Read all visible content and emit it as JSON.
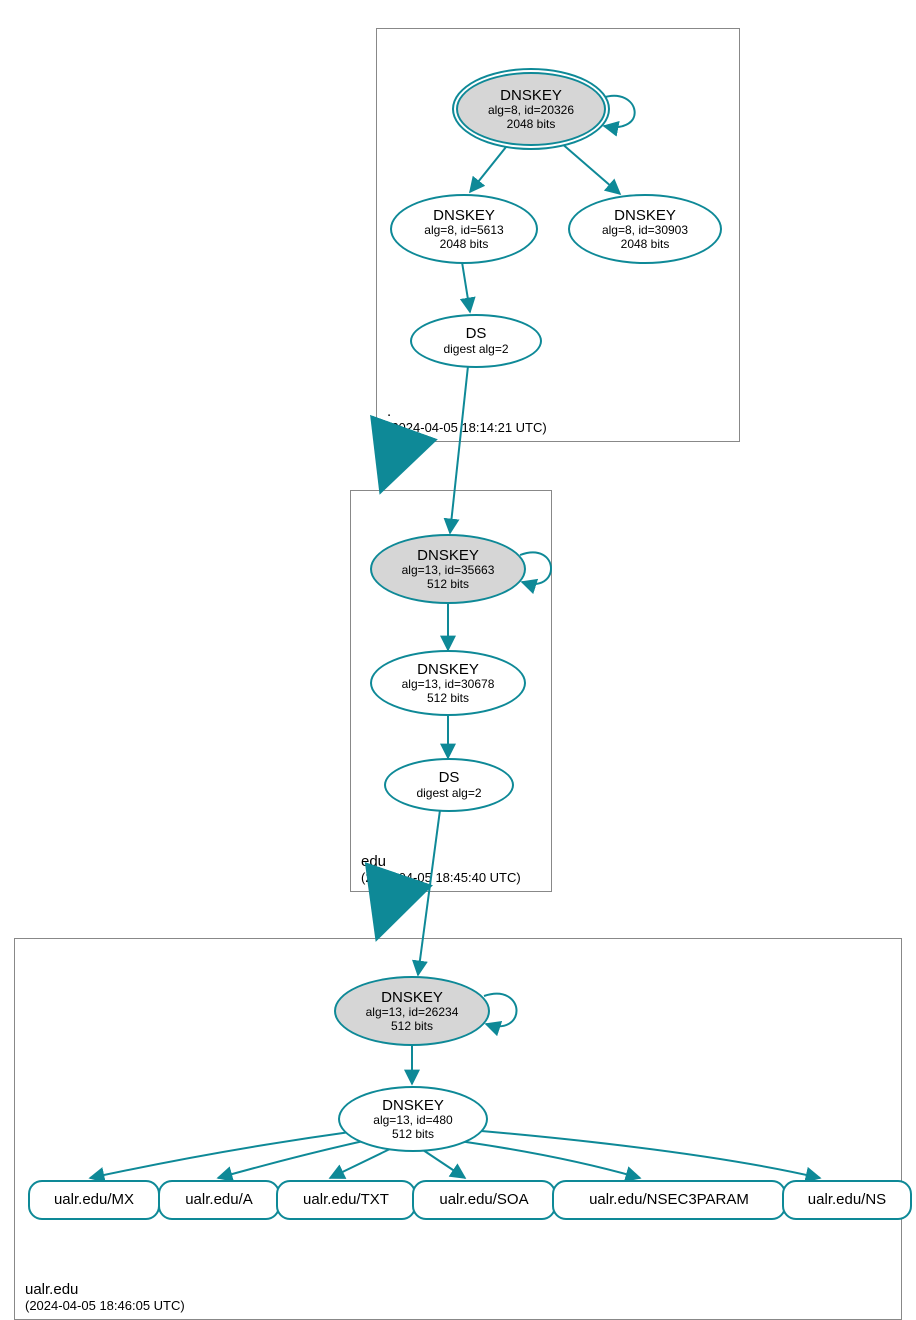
{
  "zones": {
    "root": {
      "name": ".",
      "timestamp": "(2024-04-05 18:14:21 UTC)"
    },
    "edu": {
      "name": "edu",
      "timestamp": "(2024-04-05 18:45:40 UTC)"
    },
    "ualr": {
      "name": "ualr.edu",
      "timestamp": "(2024-04-05 18:46:05 UTC)"
    }
  },
  "nodes": {
    "root_ksk": {
      "title": "DNSKEY",
      "sub1": "alg=8, id=20326",
      "sub2": "2048 bits"
    },
    "root_zsk": {
      "title": "DNSKEY",
      "sub1": "alg=8, id=5613",
      "sub2": "2048 bits"
    },
    "root_k2": {
      "title": "DNSKEY",
      "sub1": "alg=8, id=30903",
      "sub2": "2048 bits"
    },
    "root_ds": {
      "title": "DS",
      "sub1": "digest alg=2"
    },
    "edu_ksk": {
      "title": "DNSKEY",
      "sub1": "alg=13, id=35663",
      "sub2": "512 bits"
    },
    "edu_zsk": {
      "title": "DNSKEY",
      "sub1": "alg=13, id=30678",
      "sub2": "512 bits"
    },
    "edu_ds": {
      "title": "DS",
      "sub1": "digest alg=2"
    },
    "ualr_ksk": {
      "title": "DNSKEY",
      "sub1": "alg=13, id=26234",
      "sub2": "512 bits"
    },
    "ualr_zsk": {
      "title": "DNSKEY",
      "sub1": "alg=13, id=480",
      "sub2": "512 bits"
    },
    "rr_mx": {
      "label": "ualr.edu/MX"
    },
    "rr_a": {
      "label": "ualr.edu/A"
    },
    "rr_txt": {
      "label": "ualr.edu/TXT"
    },
    "rr_soa": {
      "label": "ualr.edu/SOA"
    },
    "rr_nsec3": {
      "label": "ualr.edu/NSEC3PARAM"
    },
    "rr_ns": {
      "label": "ualr.edu/NS"
    }
  },
  "colors": {
    "stroke": "#0e8997",
    "nodeFill": "#d6d6d6"
  }
}
